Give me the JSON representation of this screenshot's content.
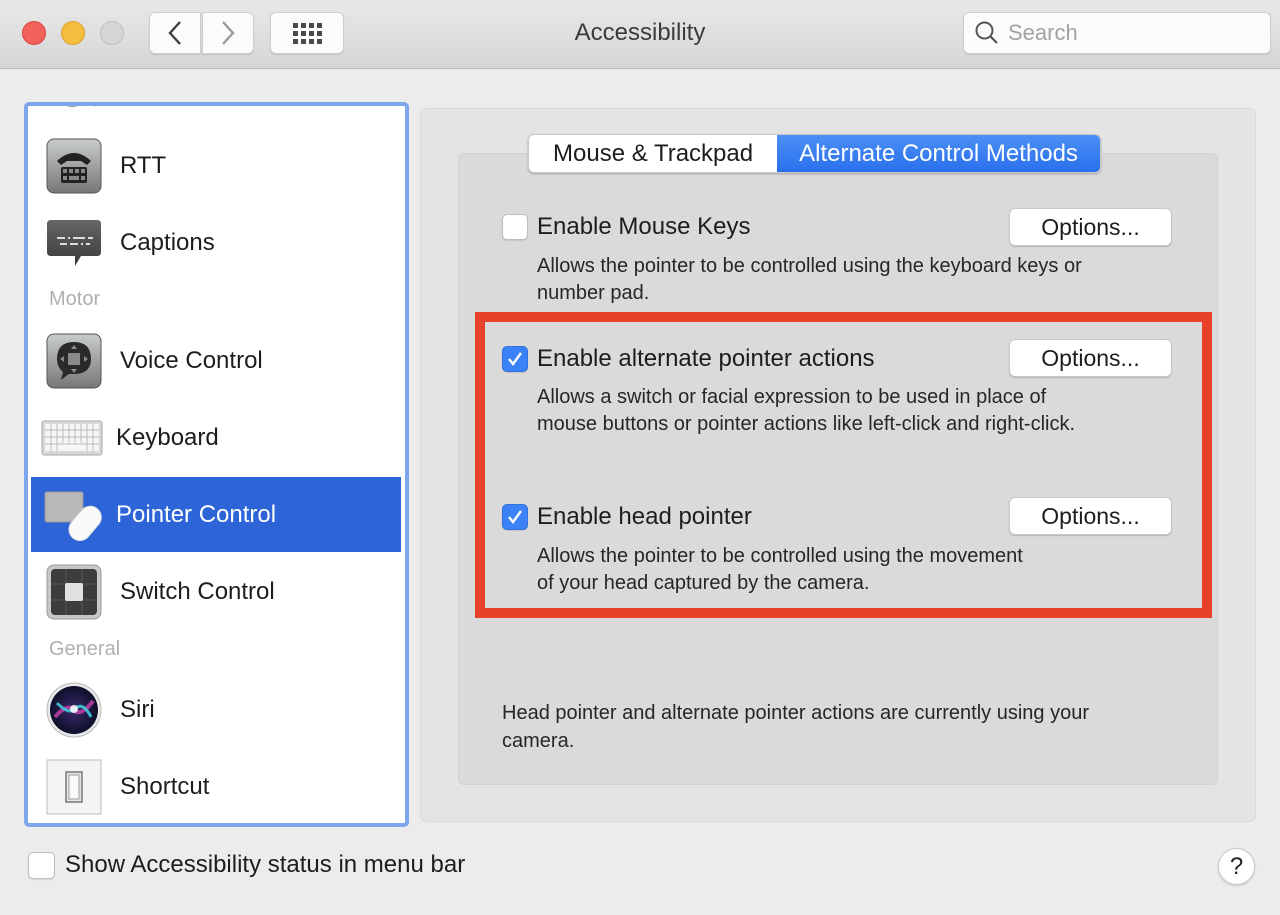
{
  "window": {
    "title": "Accessibility",
    "search_placeholder": "Search",
    "search_value": ""
  },
  "sidebar": {
    "sections": [
      {
        "label": "Motor"
      },
      {
        "label": "General"
      }
    ],
    "items": [
      {
        "label": "RTT",
        "icon": "rtt-phone-icon",
        "selected": false
      },
      {
        "label": "Captions",
        "icon": "captions-bubble-icon",
        "selected": false
      },
      {
        "label": "Voice Control",
        "icon": "voice-control-icon",
        "selected": false
      },
      {
        "label": "Keyboard",
        "icon": "keyboard-icon",
        "selected": false
      },
      {
        "label": "Pointer Control",
        "icon": "pointer-control-icon",
        "selected": true
      },
      {
        "label": "Switch Control",
        "icon": "switch-control-icon",
        "selected": false
      },
      {
        "label": "Siri",
        "icon": "siri-icon",
        "selected": false
      },
      {
        "label": "Shortcut",
        "icon": "shortcut-switch-icon",
        "selected": false
      }
    ]
  },
  "tabs": [
    {
      "label": "Mouse & Trackpad",
      "active": false
    },
    {
      "label": "Alternate Control Methods",
      "active": true
    }
  ],
  "options": [
    {
      "label": "Enable Mouse Keys",
      "checked": false,
      "description": "Allows the pointer to be controlled using the keyboard keys or number pad.",
      "button_label": "Options..."
    },
    {
      "label": "Enable alternate pointer actions",
      "checked": true,
      "description": "Allows a switch or facial expression to be used in place of mouse buttons or pointer actions like left-click and right-click.",
      "button_label": "Options..."
    },
    {
      "label": "Enable head pointer",
      "checked": true,
      "description": "Allows the pointer to be controlled using the movement of your head captured by the camera.",
      "button_label": "Options..."
    }
  ],
  "footer_note": "Head pointer and alternate pointer actions are currently using your camera.",
  "bottom": {
    "status_checkbox_label": "Show Accessibility status in menu bar",
    "status_checkbox_checked": false,
    "help_label": "?"
  },
  "colors": {
    "accent": "#2d64d8",
    "checkbox_checked": "#3b82f6",
    "highlight_annotation": "#e8412b",
    "sidebar_focus_ring": "#7ea6ec"
  }
}
